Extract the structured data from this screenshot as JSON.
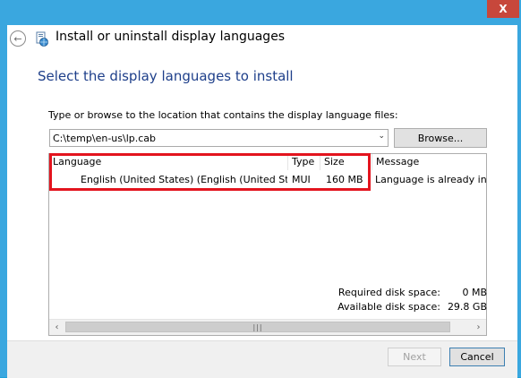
{
  "window": {
    "close_glyph": "X",
    "title": "Install or uninstall display languages"
  },
  "page": {
    "heading": "Select the display languages to install",
    "instruction": "Type or browse to the location that contains the display language files:",
    "path_value": "C:\\temp\\en-us\\lp.cab",
    "browse_label": "Browse..."
  },
  "table": {
    "columns": [
      "Language",
      "Type",
      "Size",
      "Message"
    ],
    "rows": [
      {
        "language": "English (United States) (English (United States))",
        "type": "MUI",
        "size": "160 MB",
        "message": "Language is already insta"
      }
    ]
  },
  "disk": {
    "required_label": "Required disk space:",
    "required_value": "0 MB",
    "available_label": "Available disk space:",
    "available_value": "29.8 GB"
  },
  "footer": {
    "next_label": "Next",
    "cancel_label": "Cancel"
  },
  "colors": {
    "accent": "#3aa7df",
    "heading": "#1e3f8a",
    "highlight": "#e3141e",
    "close": "#c7473b"
  },
  "icons": [
    "close-icon",
    "back-arrow-icon",
    "language-settings-icon",
    "chevron-down-icon",
    "scroll-left-icon",
    "scroll-right-icon"
  ]
}
